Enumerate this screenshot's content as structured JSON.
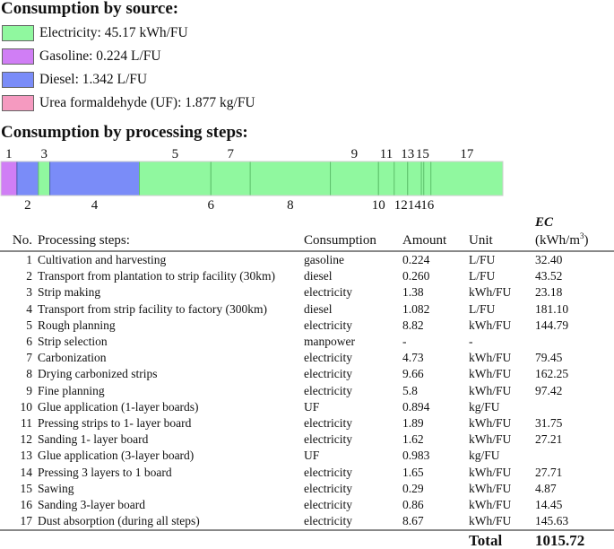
{
  "titles": {
    "source": "Consumption by source:",
    "steps": "Consumption by processing steps:"
  },
  "colors": {
    "electricity": "#90f89f",
    "gasoline": "#d07ef5",
    "diesel": "#7a8cf8",
    "uf": "#f59ac0"
  },
  "legend": [
    {
      "key": "electricity",
      "label": "Electricity: 45.17 kWh/FU"
    },
    {
      "key": "gasoline",
      "label": "Gasoline: 0.224 L/FU"
    },
    {
      "key": "diesel",
      "label": "Diesel: 1.342 L/FU"
    },
    {
      "key": "uf",
      "label": "Urea formaldehyde (UF): 1.877 kg/FU"
    }
  ],
  "table": {
    "headers": {
      "no": "No.",
      "step": "Processing steps:",
      "consumption": "Consumption",
      "amount": "Amount",
      "unit": "Unit",
      "ec_title": "EC",
      "ec_unit_pre": "(kWh/m",
      "ec_unit_sup": "3",
      "ec_unit_post": ")"
    },
    "rows": [
      {
        "no": "1",
        "step": "Cultivation and harvesting",
        "consumption": "gasoline",
        "amount": "0.224",
        "unit": "L/FU",
        "ec": "32.40"
      },
      {
        "no": "2",
        "step": "Transport from plantation to strip facility (30km)",
        "consumption": "diesel",
        "amount": "0.260",
        "unit": "L/FU",
        "ec": "43.52"
      },
      {
        "no": "3",
        "step": "Strip making",
        "consumption": "electricity",
        "amount": "1.38",
        "unit": "kWh/FU",
        "ec": "23.18"
      },
      {
        "no": "4",
        "step": "Transport from strip facility to factory (300km)",
        "consumption": "diesel",
        "amount": "1.082",
        "unit": "L/FU",
        "ec": "181.10"
      },
      {
        "no": "5",
        "step": "Rough planning",
        "consumption": "electricity",
        "amount": "8.82",
        "unit": "kWh/FU",
        "ec": "144.79"
      },
      {
        "no": "6",
        "step": "Strip selection",
        "consumption": "manpower",
        "amount": "-",
        "unit": "-",
        "ec": ""
      },
      {
        "no": "7",
        "step": "Carbonization",
        "consumption": "electricity",
        "amount": "4.73",
        "unit": "kWh/FU",
        "ec": "79.45"
      },
      {
        "no": "8",
        "step": "Drying carbonized strips",
        "consumption": "electricity",
        "amount": "9.66",
        "unit": "kWh/FU",
        "ec": "162.25"
      },
      {
        "no": "9",
        "step": "Fine planning",
        "consumption": "electricity",
        "amount": "5.8",
        "unit": "kWh/FU",
        "ec": "97.42"
      },
      {
        "no": "10",
        "step": "Glue application (1-layer boards)",
        "consumption": "UF",
        "amount": "0.894",
        "unit": "kg/FU",
        "ec": ""
      },
      {
        "no": "11",
        "step": "Pressing strips to 1- layer board",
        "consumption": "electricity",
        "amount": "1.89",
        "unit": "kWh/FU",
        "ec": "31.75"
      },
      {
        "no": "12",
        "step": "Sanding 1- layer board",
        "consumption": "electricity",
        "amount": "1.62",
        "unit": "kWh/FU",
        "ec": "27.21"
      },
      {
        "no": "13",
        "step": "Glue application (3-layer board)",
        "consumption": "UF",
        "amount": "0.983",
        "unit": "kg/FU",
        "ec": ""
      },
      {
        "no": "14",
        "step": "Pressing 3 layers to 1 board",
        "consumption": "electricity",
        "amount": "1.65",
        "unit": "kWh/FU",
        "ec": "27.71"
      },
      {
        "no": "15",
        "step": "Sawing",
        "consumption": "electricity",
        "amount": "0.29",
        "unit": "kWh/FU",
        "ec": "4.87"
      },
      {
        "no": "16",
        "step": "Sanding 3-layer board",
        "consumption": "electricity",
        "amount": "0.86",
        "unit": "kWh/FU",
        "ec": "14.45"
      },
      {
        "no": "17",
        "step": "Dust absorption (during all steps)",
        "consumption": "electricity",
        "amount": "8.67",
        "unit": "kWh/FU",
        "ec": "145.63"
      }
    ],
    "total_label": "Total",
    "total_value": "1015.72"
  },
  "chart_data": {
    "type": "bar",
    "orientation": "horizontal-stacked",
    "title": "Consumption by processing steps:",
    "categories": [
      "1",
      "2",
      "3",
      "4",
      "5",
      "6",
      "7",
      "8",
      "9",
      "10",
      "11",
      "12",
      "13",
      "14",
      "15",
      "16",
      "17"
    ],
    "sources": [
      "gasoline",
      "diesel",
      "electricity",
      "diesel",
      "electricity",
      "electricity",
      "electricity",
      "electricity",
      "electricity",
      "electricity",
      "electricity",
      "electricity",
      "electricity",
      "electricity",
      "electricity",
      "electricity",
      "electricity"
    ],
    "values": [
      32.4,
      43.52,
      23.18,
      181.1,
      144.79,
      0,
      79.45,
      162.25,
      97.42,
      0,
      31.75,
      27.21,
      0,
      27.71,
      4.87,
      14.45,
      145.63
    ],
    "label_positions": [
      "top",
      "bottom",
      "top",
      "bottom",
      "top",
      "bottom",
      "top",
      "bottom",
      "top",
      "bottom",
      "top",
      "bottom",
      "top",
      "bottom",
      "top",
      "bottom",
      "top"
    ],
    "unit": "kWh/m3",
    "total": 1015.72,
    "legend": [
      "Electricity: 45.17 kWh/FU",
      "Gasoline: 0.224 L/FU",
      "Diesel: 1.342 L/FU",
      "Urea formaldehyde (UF): 1.877 kg/FU"
    ],
    "legend_placement": "top"
  }
}
